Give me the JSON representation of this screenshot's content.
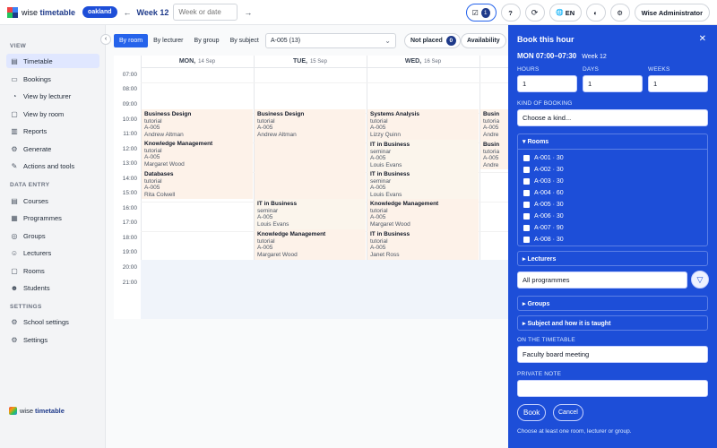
{
  "topbar": {
    "logo_text_pre": "wise",
    "logo_text_bold": "timetable",
    "school": "oakland",
    "prev": "←",
    "next": "→",
    "week": "Week 12",
    "date_placeholder": "Week or date",
    "notifications_count": "1",
    "help": "?",
    "sync": "⟳",
    "globe": "🌐",
    "language": "EN",
    "palette": "◐",
    "gear": "⚙",
    "user": "Wise Administrator"
  },
  "sidebar": {
    "view_heading": "VIEW",
    "view_items": [
      {
        "label": "Timetable",
        "icon": "▤"
      },
      {
        "label": "Bookings",
        "icon": "▭"
      },
      {
        "label": "View by lecturer",
        "icon": "◔"
      },
      {
        "label": "View by room",
        "icon": "▢"
      },
      {
        "label": "Reports",
        "icon": "▥"
      },
      {
        "label": "Generate",
        "icon": "⚙"
      },
      {
        "label": "Actions and tools",
        "icon": "✎"
      }
    ],
    "data_heading": "DATA ENTRY",
    "data_items": [
      {
        "label": "Courses",
        "icon": "▤"
      },
      {
        "label": "Programmes",
        "icon": "▦"
      },
      {
        "label": "Groups",
        "icon": "◎"
      },
      {
        "label": "Lecturers",
        "icon": "☺"
      },
      {
        "label": "Rooms",
        "icon": "▢"
      },
      {
        "label": "Students",
        "icon": "☻"
      }
    ],
    "settings_heading": "SETTINGS",
    "settings_items": [
      {
        "label": "School settings",
        "icon": "⚙"
      },
      {
        "label": "Settings",
        "icon": "⚙"
      }
    ],
    "footer_pre": "wise",
    "footer_bold": "timetable"
  },
  "toolbar": {
    "collapse": "‹",
    "tabs": [
      "By room",
      "By lecturer",
      "By group",
      "By subject"
    ],
    "room": "A-005 (13)",
    "chevron": "⌄",
    "not_placed": "Not placed",
    "not_placed_count": "0",
    "availability": "Availability"
  },
  "calendar": {
    "days": [
      {
        "name": "MON,",
        "date": "14 Sep"
      },
      {
        "name": "TUE,",
        "date": "15 Sep"
      },
      {
        "name": "WED,",
        "date": "16 Sep"
      }
    ],
    "times": [
      "07:00",
      "08:00",
      "09:00",
      "10:00",
      "11:00",
      "12:00",
      "13:00",
      "14:00",
      "15:00",
      "16:00",
      "17:00",
      "18:00",
      "19:00",
      "20:00",
      "21:00"
    ],
    "events": {
      "mon": [
        {
          "title": "Business Design",
          "type": "tutorial",
          "room": "A-005",
          "who": "Andrew Altman"
        },
        {
          "title": "Knowledge Management",
          "type": "tutorial",
          "room": "A-005",
          "who": "Margaret Wood"
        },
        {
          "title": "Databases",
          "type": "tutorial",
          "room": "A-005",
          "who": "Rita Colwell"
        }
      ],
      "tue": [
        {
          "title": "Business Design",
          "type": "tutorial",
          "room": "A-005",
          "who": "Andrew Altman"
        },
        {
          "title": "IT in Business",
          "type": "seminar",
          "room": "A-005",
          "who": "Louis Evans"
        },
        {
          "title": "Knowledge Management",
          "type": "tutorial",
          "room": "A-005",
          "who": "Margaret Wood"
        }
      ],
      "wed": [
        {
          "title": "Systems Analysis",
          "type": "tutorial",
          "room": "A-005",
          "who": "Lizzy Quinn"
        },
        {
          "title": "IT in Business",
          "type": "seminar",
          "room": "A-005",
          "who": "Louis Evans"
        },
        {
          "title": "IT in Business",
          "type": "seminar",
          "room": "A-005",
          "who": "Louis Evans"
        },
        {
          "title": "Knowledge Management",
          "type": "tutorial",
          "room": "A-005",
          "who": "Margaret Wood"
        },
        {
          "title": "IT in Business",
          "type": "tutorial",
          "room": "A-005",
          "who": "Janet Ross"
        }
      ],
      "thu": [
        {
          "title": "Busin",
          "type": "tutoria",
          "room": "A-005",
          "who": "Andre"
        },
        {
          "title": "Busin",
          "type": "tutoria",
          "room": "A-005",
          "who": "Andre"
        }
      ]
    }
  },
  "panel": {
    "title": "Book this hour",
    "close": "✕",
    "when": "MON 07:00–07:30",
    "week": "Week 12",
    "hours_label": "HOURS",
    "days_label": "DAYS",
    "weeks_label": "WEEKS",
    "hours": "1",
    "days": "1",
    "weeks": "1",
    "kind_label": "KIND OF BOOKING",
    "kind_value": "Choose a kind...",
    "rooms_head": "▾ Rooms",
    "rooms": [
      "A-001 · 30",
      "A-002 · 30",
      "A-003 · 30",
      "A-004 · 60",
      "A-005 · 30",
      "A-006 · 30",
      "A-007 · 90",
      "A-008 · 30"
    ],
    "lecturers_head": "▸ Lecturers",
    "programmes_value": "All programmes",
    "filter_icon": "▽",
    "groups_head": "▸ Groups",
    "subject_head": "▸ Subject and how it is taught",
    "on_timetable_label": "ON THE TIMETABLE",
    "on_timetable_value": "Faculty board meeting",
    "private_note_label": "PRIVATE NOTE",
    "private_note_value": "",
    "book": "Book",
    "cancel": "Cancel",
    "hint": "Choose at least one room, lecturer or group."
  },
  "colors": {
    "accent": "#1d4ed8",
    "sidebar_bg": "#f3f4f6",
    "event_bg": "#fdf2e9"
  }
}
